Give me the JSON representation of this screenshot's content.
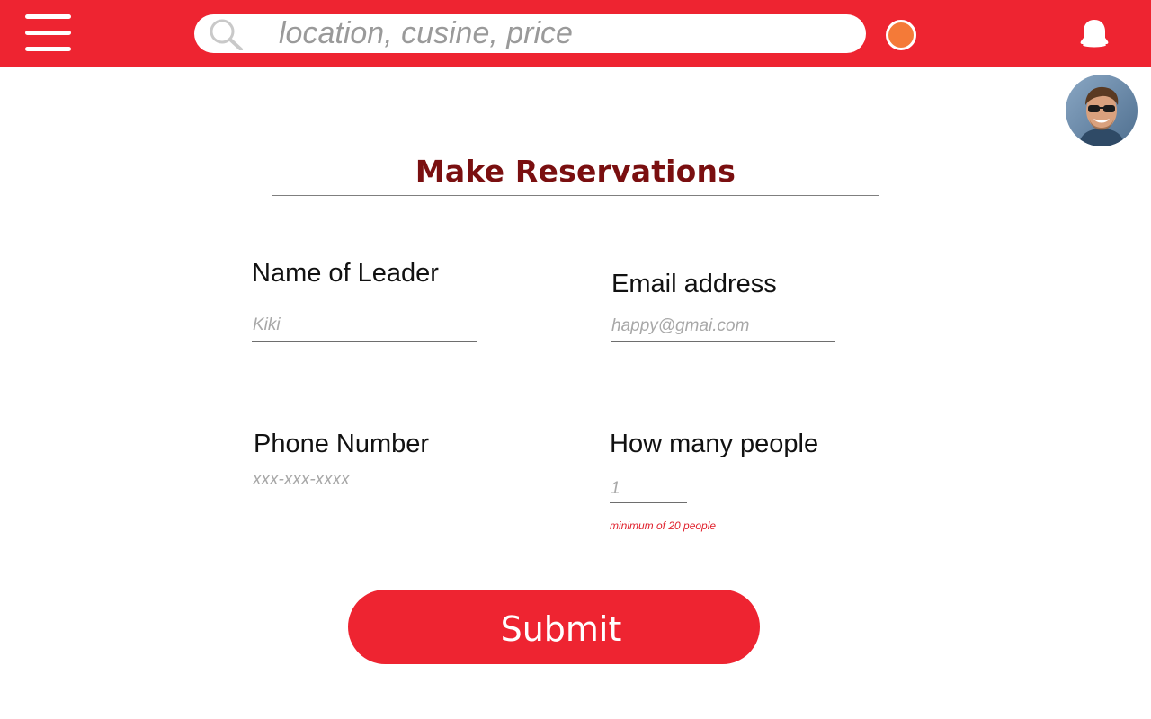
{
  "topbar": {
    "search": {
      "placeholder": "location, cusine, price",
      "value": ""
    },
    "icons": {
      "menu": "hamburger-menu-icon",
      "search": "search-icon",
      "status": "status-dot",
      "notifications": "bell-icon",
      "profile": "avatar"
    }
  },
  "form": {
    "title": "Make Reservations",
    "fields": {
      "leader": {
        "label": "Name of Leader",
        "placeholder": "Kiki"
      },
      "email": {
        "label": "Email address",
        "placeholder": "happy@gmai.com"
      },
      "phone": {
        "label": "Phone Number",
        "placeholder": "xxx-xxx-xxxx"
      },
      "people": {
        "label": "How many people",
        "placeholder": "1",
        "hint": "minimum of 20 people"
      }
    },
    "submit_label": "Submit"
  },
  "colors": {
    "brand_red": "#ee2431",
    "title_maroon": "#7a0f10",
    "status_orange": "#f47a38",
    "hint_red": "#e0202c"
  }
}
